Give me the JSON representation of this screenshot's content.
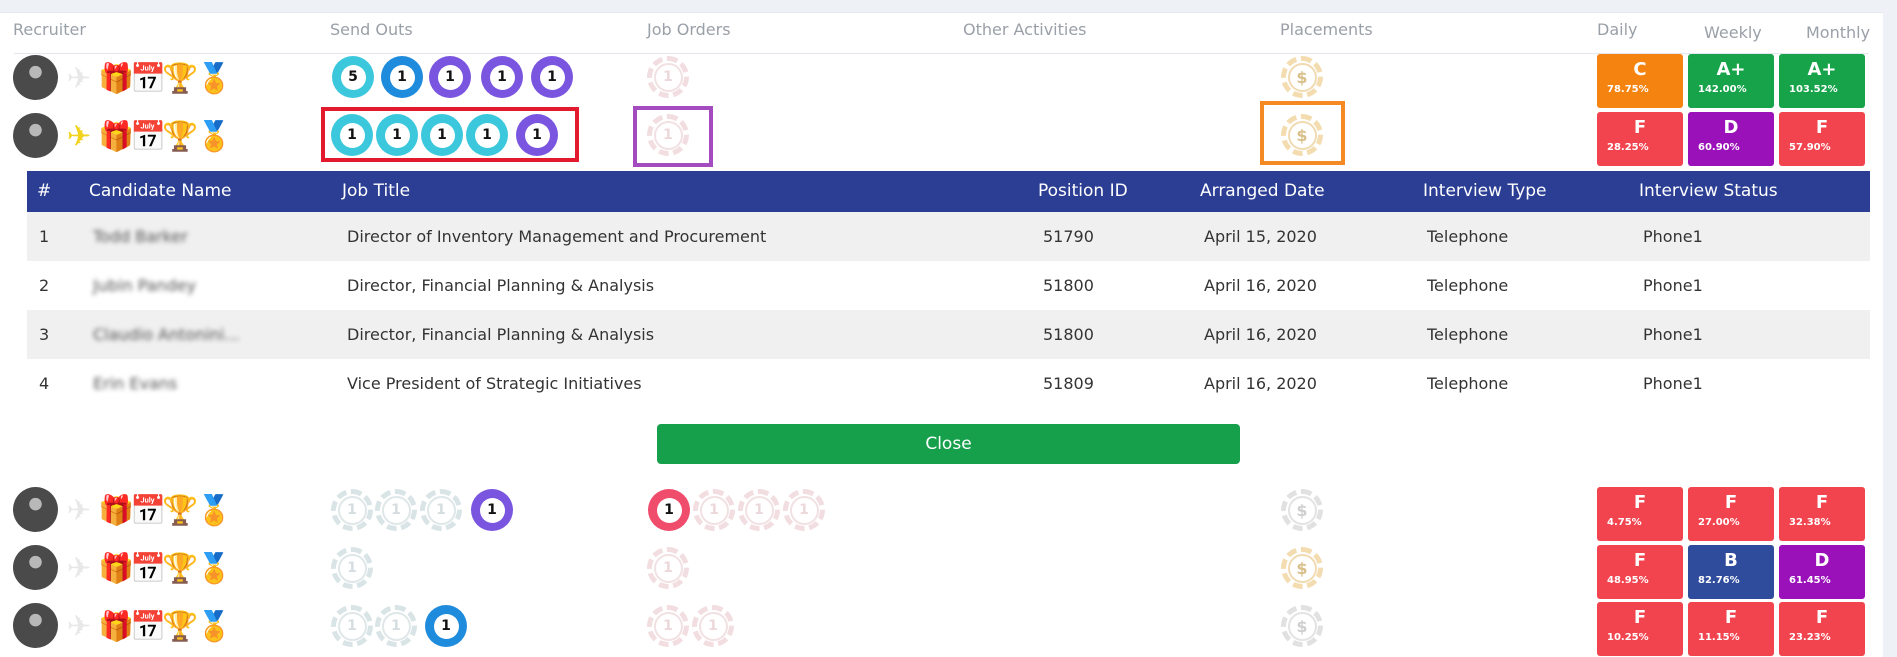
{
  "headers": {
    "recruiter": "Recruiter",
    "send_outs": "Send Outs",
    "job_orders": "Job Orders",
    "other_activities": "Other Activities",
    "placements": "Placements",
    "daily": "Daily",
    "weekly": "Weekly",
    "monthly": "Monthly"
  },
  "icons": {
    "plane": "✈",
    "gift": "🎁",
    "calendar": "📅",
    "trophy": "🏆",
    "medal": "🏅",
    "dollar": "$"
  },
  "colors": {
    "table_header": "#2b3e94",
    "close_button": "#16a04b",
    "grade_orange": "#f5830f",
    "grade_green": "#17a34a",
    "grade_red": "#f2444f",
    "grade_purple": "#9a11b9",
    "grade_blue": "#2f4b9c",
    "highlight_red": "#e31a2e",
    "highlight_purple": "#a44cbf",
    "highlight_orange": "#f58a25"
  },
  "rows": [
    {
      "send_out_chips": [
        "5",
        "1",
        "1",
        "1",
        "1"
      ],
      "job_order_chips": [
        "1"
      ],
      "placement_symbol": "$",
      "grades": [
        {
          "letter": "C",
          "percent": "78.75%",
          "color": "#f5830f"
        },
        {
          "letter": "A+",
          "percent": "142.00%",
          "color": "#17a34a"
        },
        {
          "letter": "A+",
          "percent": "103.52%",
          "color": "#17a34a"
        }
      ]
    },
    {
      "send_out_chips": [
        "1",
        "1",
        "1",
        "1",
        "1"
      ],
      "job_order_chips": [
        "1"
      ],
      "placement_symbol": "$",
      "grades": [
        {
          "letter": "F",
          "percent": "28.25%",
          "color": "#f2444f"
        },
        {
          "letter": "D",
          "percent": "60.90%",
          "color": "#9a11b9"
        },
        {
          "letter": "F",
          "percent": "57.90%",
          "color": "#f2444f"
        }
      ]
    },
    {
      "send_out_chips": [
        "1",
        "1",
        "1",
        "1"
      ],
      "job_order_chips": [
        "1",
        "1",
        "1",
        "1"
      ],
      "placement_symbol": "$",
      "grades": [
        {
          "letter": "F",
          "percent": "4.75%",
          "color": "#f2444f"
        },
        {
          "letter": "F",
          "percent": "27.00%",
          "color": "#f2444f"
        },
        {
          "letter": "F",
          "percent": "32.38%",
          "color": "#f2444f"
        }
      ]
    },
    {
      "send_out_chips": [
        "1"
      ],
      "job_order_chips": [
        "1"
      ],
      "placement_symbol": "$",
      "grades": [
        {
          "letter": "F",
          "percent": "48.95%",
          "color": "#f2444f"
        },
        {
          "letter": "B",
          "percent": "82.76%",
          "color": "#2f4b9c"
        },
        {
          "letter": "D",
          "percent": "61.45%",
          "color": "#9a11b9"
        }
      ]
    },
    {
      "send_out_chips": [
        "1",
        "1",
        "1"
      ],
      "job_order_chips": [
        "1",
        "1"
      ],
      "placement_symbol": "$",
      "grades": [
        {
          "letter": "F",
          "percent": "10.25%",
          "color": "#f2444f"
        },
        {
          "letter": "F",
          "percent": "11.15%",
          "color": "#f2444f"
        },
        {
          "letter": "F",
          "percent": "23.23%",
          "color": "#f2444f"
        }
      ]
    }
  ],
  "detail_table": {
    "columns": [
      "#",
      "Candidate Name",
      "Job Title",
      "Position ID",
      "Arranged Date",
      "Interview Type",
      "Interview Status"
    ],
    "rows": [
      {
        "num": "1",
        "candidate": "Todd Barker",
        "job_title": "Director of Inventory Management and Procurement",
        "position_id": "51790",
        "arranged_date": "April 15, 2020",
        "interview_type": "Telephone",
        "interview_status": "Phone1"
      },
      {
        "num": "2",
        "candidate": "Jubin Pandey",
        "job_title": "Director, Financial Planning & Analysis",
        "position_id": "51800",
        "arranged_date": "April 16, 2020",
        "interview_type": "Telephone",
        "interview_status": "Phone1"
      },
      {
        "num": "3",
        "candidate": "Claudio Antonini...",
        "job_title": "Director, Financial Planning & Analysis",
        "position_id": "51800",
        "arranged_date": "April 16, 2020",
        "interview_type": "Telephone",
        "interview_status": "Phone1"
      },
      {
        "num": "4",
        "candidate": "Erin Evans",
        "job_title": "Vice President of Strategic Initiatives",
        "position_id": "51809",
        "arranged_date": "April 16, 2020",
        "interview_type": "Telephone",
        "interview_status": "Phone1"
      }
    ]
  },
  "close_label": "Close"
}
